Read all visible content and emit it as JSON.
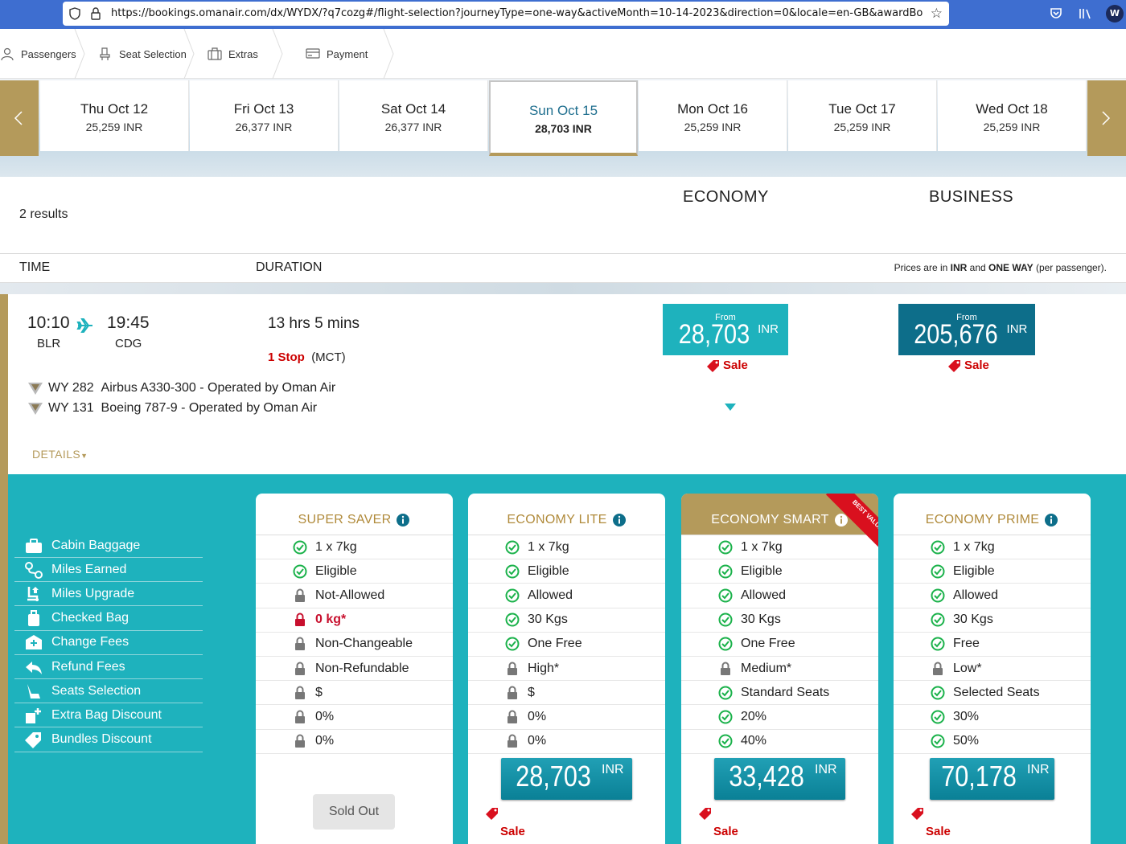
{
  "browser": {
    "url": "https://bookings.omanair.com/dx/WYDX/?q7cozg#/flight-selection?journeyType=one-way&activeMonth=10-14-2023&direction=0&locale=en-GB&awardBooking",
    "avatar_letter": "W"
  },
  "steps": [
    {
      "label": "Passengers",
      "icon": "person-icon"
    },
    {
      "label": "Seat Selection",
      "icon": "seat-icon"
    },
    {
      "label": "Extras",
      "icon": "luggage-icon"
    },
    {
      "label": "Payment",
      "icon": "card-icon"
    }
  ],
  "dates": [
    {
      "day": "Thu Oct 12",
      "price": "25,259 INR"
    },
    {
      "day": "Fri Oct 13",
      "price": "26,377 INR"
    },
    {
      "day": "Sat Oct 14",
      "price": "26,377 INR"
    },
    {
      "day": "Sun Oct 15",
      "price": "28,703 INR"
    },
    {
      "day": "Mon Oct 16",
      "price": "25,259 INR"
    },
    {
      "day": "Tue Oct 17",
      "price": "25,259 INR"
    },
    {
      "day": "Wed Oct 18",
      "price": "25,259 INR"
    }
  ],
  "active_date_index": 3,
  "results": {
    "count": "2 results",
    "economy": "ECONOMY",
    "business": "BUSINESS",
    "time_header": "TIME",
    "duration_header": "DURATION",
    "prices_note_prefix": "Prices are in ",
    "prices_note_cur": "INR",
    "prices_note_mid": " and ",
    "prices_note_way": "ONE WAY",
    "prices_note_suffix": " (per passenger)."
  },
  "flight": {
    "dep_time": "10:10",
    "arr_time": "19:45",
    "from": "BLR",
    "to": "CDG",
    "duration": "13 hrs 5 mins",
    "stops": "1 Stop",
    "via": "(MCT)",
    "segments": [
      {
        "flight": "WY 282",
        "aircraft": "Airbus A330-300",
        "operator": "Operated by Oman Air"
      },
      {
        "flight": "WY 131",
        "aircraft": "Boeing 787-9",
        "operator": "Operated by Oman Air"
      }
    ],
    "details_label": "DETAILS",
    "economy_from": {
      "label": "From",
      "amount": "28,703",
      "currency": "INR",
      "sale": "Sale"
    },
    "business_from": {
      "label": "From",
      "amount": "205,676",
      "currency": "INR",
      "sale": "Sale"
    }
  },
  "legend": [
    {
      "label": "Cabin Baggage",
      "icon": "briefcase-icon"
    },
    {
      "label": "Miles Earned",
      "icon": "miles-icon"
    },
    {
      "label": "Miles Upgrade",
      "icon": "upgrade-seat-icon"
    },
    {
      "label": "Checked Bag",
      "icon": "suitcase-icon"
    },
    {
      "label": "Change Fees",
      "icon": "change-icon"
    },
    {
      "label": "Refund Fees",
      "icon": "refund-icon"
    },
    {
      "label": "Seats Selection",
      "icon": "seat-select-icon"
    },
    {
      "label": "Extra Bag Discount",
      "icon": "extra-bag-icon"
    },
    {
      "label": "Bundles Discount",
      "icon": "tag-icon"
    }
  ],
  "fares": [
    {
      "name": "SUPER SAVER",
      "rows": [
        {
          "text": "1 x 7kg",
          "icon": "check"
        },
        {
          "text": "Eligible",
          "icon": "check"
        },
        {
          "text": "Not-Allowed",
          "icon": "lock"
        },
        {
          "text": "0 kg*",
          "icon": "lock-red"
        },
        {
          "text": "Non-Changeable",
          "icon": "lock"
        },
        {
          "text": "Non-Refundable",
          "icon": "lock"
        },
        {
          "text": "$",
          "icon": "lock"
        },
        {
          "text": "0%",
          "icon": "lock"
        },
        {
          "text": "0%",
          "icon": "lock"
        }
      ],
      "sold_out": "Sold Out"
    },
    {
      "name": "ECONOMY LITE",
      "rows": [
        {
          "text": "1 x 7kg",
          "icon": "check"
        },
        {
          "text": "Eligible",
          "icon": "check"
        },
        {
          "text": "Allowed",
          "icon": "check"
        },
        {
          "text": "30 Kgs",
          "icon": "check"
        },
        {
          "text": "One Free",
          "icon": "check"
        },
        {
          "text": "High*",
          "icon": "lock"
        },
        {
          "text": "$",
          "icon": "lock"
        },
        {
          "text": "0%",
          "icon": "lock"
        },
        {
          "text": "0%",
          "icon": "lock"
        }
      ],
      "price": "28,703",
      "currency": "INR",
      "sale": "Sale"
    },
    {
      "name": "ECONOMY SMART",
      "badge": "BEST VALUE",
      "rows": [
        {
          "text": "1 x 7kg",
          "icon": "check"
        },
        {
          "text": "Eligible",
          "icon": "check"
        },
        {
          "text": "Allowed",
          "icon": "check"
        },
        {
          "text": "30 Kgs",
          "icon": "check"
        },
        {
          "text": "One Free",
          "icon": "check"
        },
        {
          "text": "Medium*",
          "icon": "lock"
        },
        {
          "text": "Standard Seats",
          "icon": "check"
        },
        {
          "text": "20%",
          "icon": "check"
        },
        {
          "text": "40%",
          "icon": "check"
        }
      ],
      "price": "33,428",
      "currency": "INR",
      "sale": "Sale"
    },
    {
      "name": "ECONOMY PRIME",
      "rows": [
        {
          "text": "1 x 7kg",
          "icon": "check"
        },
        {
          "text": "Eligible",
          "icon": "check"
        },
        {
          "text": "Allowed",
          "icon": "check"
        },
        {
          "text": "30 Kgs",
          "icon": "check"
        },
        {
          "text": "Free",
          "icon": "check"
        },
        {
          "text": "Low*",
          "icon": "lock"
        },
        {
          "text": "Selected Seats",
          "icon": "check"
        },
        {
          "text": "30%",
          "icon": "check"
        },
        {
          "text": "50%",
          "icon": "check"
        }
      ],
      "price": "70,178",
      "currency": "INR",
      "sale": "Sale"
    }
  ],
  "colors": {
    "gold": "#b49a5b",
    "teal": "#1eb2bd",
    "navy_price": "#0d6e8a",
    "sale_red": "#c00"
  }
}
